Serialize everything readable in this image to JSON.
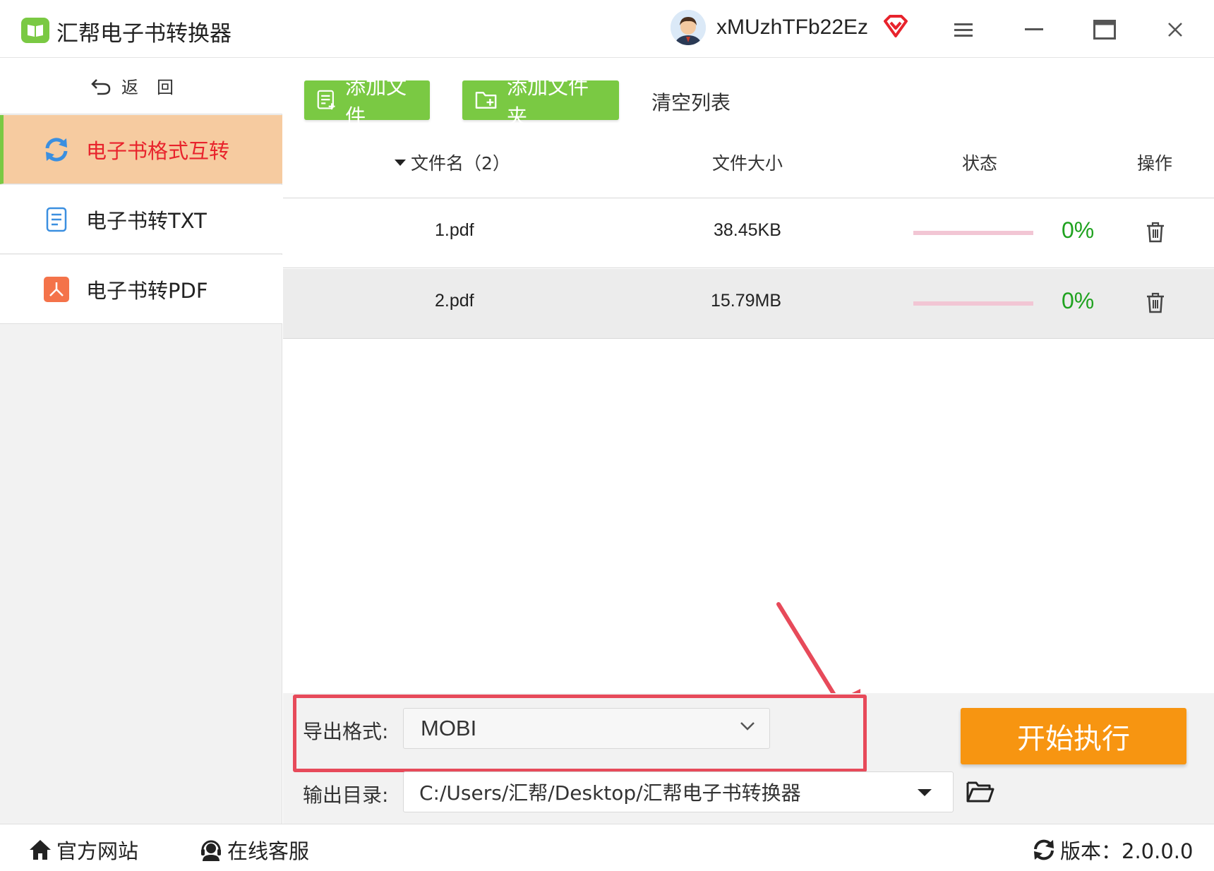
{
  "window": {
    "title": "汇帮电子书转换器",
    "username": "xMUzhTFb22Ez"
  },
  "sidebar": {
    "back_label": "返回",
    "items": [
      {
        "label": "电子书格式互转",
        "active": true
      },
      {
        "label": "电子书转TXT",
        "active": false
      },
      {
        "label": "电子书转PDF",
        "active": false
      }
    ]
  },
  "toolbar": {
    "add_file": "添加文件",
    "add_folder": "添加文件夹",
    "clear_list": "清空列表"
  },
  "table": {
    "columns": [
      "文件名（2）",
      "文件大小",
      "状态",
      "操作"
    ],
    "rows": [
      {
        "name": "1.pdf",
        "size": "38.45KB",
        "progress_pct": 0,
        "status": "0%"
      },
      {
        "name": "2.pdf",
        "size": "15.79MB",
        "progress_pct": 0,
        "status": "0%"
      }
    ]
  },
  "settings": {
    "format_label": "导出格式:",
    "format_value": "MOBI",
    "dir_label": "输出目录:",
    "dir_value": "C:/Users/汇帮/Desktop/汇帮电子书转换器",
    "start_button": "开始执行"
  },
  "statusbar": {
    "website": "官方网站",
    "support": "在线客服",
    "version": "版本：2.0.0.0"
  },
  "colors": {
    "accent_green": "#7ac943",
    "active_bg": "#f6cba0",
    "active_text": "#e8232c",
    "start_orange": "#f79511",
    "percent_green": "#1fa21f",
    "annotation_red": "#e74a5a"
  },
  "icons": [
    "app-logo-icon",
    "vip-diamond-icon",
    "menu-icon",
    "minimize-icon",
    "maximize-icon",
    "close-icon",
    "back-arrow-icon",
    "sync-icon",
    "txt-document-icon",
    "pdf-icon",
    "add-file-icon",
    "add-folder-icon",
    "sort-caret-icon",
    "trash-icon",
    "chevron-down-icon",
    "folder-open-icon",
    "home-icon",
    "headset-icon",
    "refresh-icon"
  ]
}
